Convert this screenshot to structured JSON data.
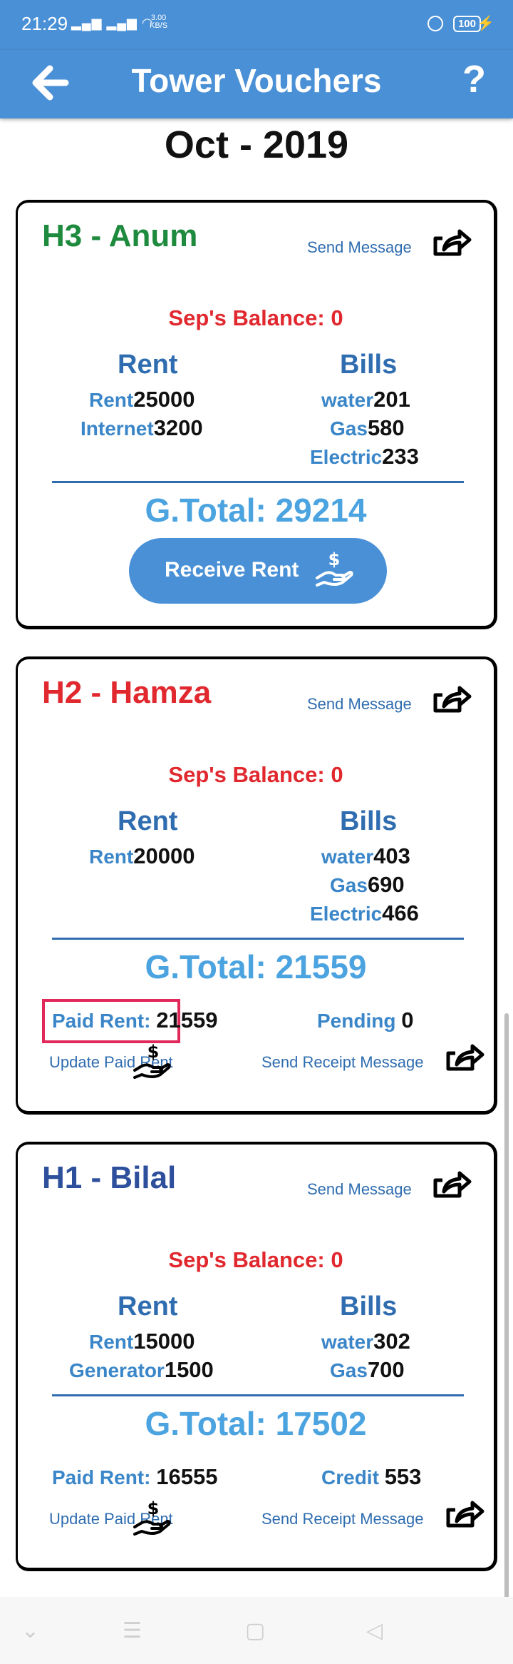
{
  "status": {
    "time": "21:29",
    "speed_top": "3.00",
    "speed_bottom": "KB/S",
    "battery": "100"
  },
  "appbar": {
    "title": "Tower Vouchers",
    "help": "?"
  },
  "month": "Oct - 2019",
  "colors": {
    "primary": "#4a90d6",
    "green": "#1e8a3e",
    "red": "#e0282e",
    "navy": "#2d4f9c",
    "light_blue": "#4ba3e0"
  },
  "cards": [
    {
      "name": "H3 - Anum",
      "send_message": "Send Message",
      "balance": "Sep's Balance: 0",
      "rent_title": "Rent",
      "bills_title": "Bills",
      "rent_items": [
        {
          "label": "Rent",
          "value": "25000"
        },
        {
          "label": "Internet",
          "value": "3200"
        }
      ],
      "bill_items": [
        {
          "label": "water",
          "value": "201"
        },
        {
          "label": "Gas",
          "value": "580"
        },
        {
          "label": "Electric",
          "value": "233"
        }
      ],
      "g_total": "G.Total: 29214",
      "receive_rent": "Receive Rent"
    },
    {
      "name": "H2 - Hamza",
      "send_message": "Send Message",
      "balance": "Sep's Balance: 0",
      "rent_title": "Rent",
      "bills_title": "Bills",
      "rent_items": [
        {
          "label": "Rent",
          "value": "20000"
        }
      ],
      "bill_items": [
        {
          "label": "water",
          "value": "403"
        },
        {
          "label": "Gas",
          "value": "690"
        },
        {
          "label": "Electric",
          "value": "466"
        }
      ],
      "g_total": "G.Total: 21559",
      "paid_label": "Paid Rent: ",
      "paid_value": "21559",
      "status_label": "Pending ",
      "status_value": "0",
      "update_paid": "Update Paid Rent",
      "send_receipt": "Send Receipt Message"
    },
    {
      "name": "H1 - Bilal",
      "send_message": "Send Message",
      "balance": "Sep's Balance: 0",
      "rent_title": "Rent",
      "bills_title": "Bills",
      "rent_items": [
        {
          "label": "Rent",
          "value": "15000"
        },
        {
          "label": "Generator",
          "value": "1500"
        }
      ],
      "bill_items": [
        {
          "label": "water",
          "value": "302"
        },
        {
          "label": "Gas",
          "value": "700"
        }
      ],
      "g_total": "G.Total: 17502",
      "paid_label": "Paid Rent: ",
      "paid_value": "16555",
      "status_label": "Credit ",
      "status_value": "553",
      "update_paid": "Update Paid Rent",
      "send_receipt": "Send Receipt Message"
    }
  ]
}
